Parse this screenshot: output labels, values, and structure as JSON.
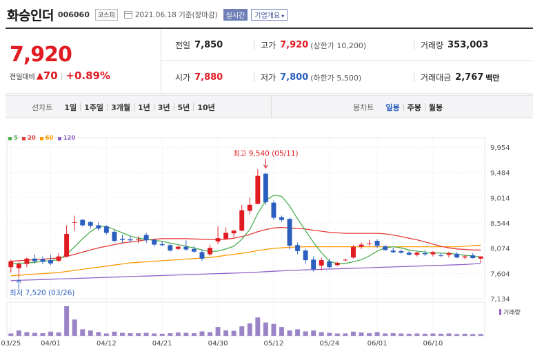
{
  "header": {
    "name": "화승인더",
    "code": "006060",
    "market": "코스피",
    "date": "2021.06.18 기준(장마감)",
    "realtime": "실시간",
    "company_info": "기업개요"
  },
  "quote": {
    "current": "7,920",
    "change_label": "전일대비",
    "change_amount": "70",
    "change_percent": "+0.89%",
    "prev_close_label": "전일",
    "prev_close": "7,850",
    "high_label": "고가",
    "high": "7,920",
    "upper_limit": "(상한가 10,200)",
    "volume_label": "거래량",
    "volume": "353,003",
    "open_label": "시가",
    "open": "7,880",
    "low_label": "저가",
    "low": "7,800",
    "lower_limit": "(하한가 5,500)",
    "amount_label": "거래대금",
    "amount": "2,767",
    "amount_unit": "백만"
  },
  "period_bar": {
    "line_chart_label": "선차트",
    "ranges": [
      "1일",
      "1주일",
      "3개월",
      "1년",
      "3년",
      "5년",
      "10년"
    ],
    "candle_label": "봉차트",
    "candle_options": [
      "일봉",
      "주봉",
      "월봉"
    ],
    "active_candle": "일봉"
  },
  "colors": {
    "up": "#e11b22",
    "down": "#2b5fbf",
    "ma5": "#4caf50",
    "ma20": "#e53935",
    "ma60": "#ff9800",
    "ma120": "#8e63c9",
    "volume": "#9a84c7"
  },
  "legend": [
    {
      "label": "5",
      "color": "#4caf50"
    },
    {
      "label": "20",
      "color": "#e53935"
    },
    {
      "label": "60",
      "color": "#ff9800"
    },
    {
      "label": "120",
      "color": "#8e63c9"
    }
  ],
  "chart_data": {
    "type": "candlestick",
    "y_ticks": [
      "9,954",
      "9,484",
      "9,014",
      "8,544",
      "8,074",
      "7,604",
      "7,134"
    ],
    "ylim": [
      7134,
      9954
    ],
    "x_ticks": [
      {
        "label": "03/25",
        "index": 0
      },
      {
        "label": "04/01",
        "index": 5
      },
      {
        "label": "04/12",
        "index": 12
      },
      {
        "label": "04/21",
        "index": 19
      },
      {
        "label": "04/30",
        "index": 26
      },
      {
        "label": "05/12",
        "index": 33
      },
      {
        "label": "05/24",
        "index": 40
      },
      {
        "label": "06/01",
        "index": 46
      },
      {
        "label": "06/10",
        "index": 53
      }
    ],
    "high_annotation": {
      "text": "최고 9,540 (05/11)",
      "value": 9540,
      "index": 32
    },
    "low_annotation": {
      "text": "최저 7,520 (03/26)",
      "value": 7520,
      "index": 1
    },
    "volume_label": "거래량",
    "candles": [
      {
        "o": 7720,
        "h": 7860,
        "l": 7620,
        "c": 7830
      },
      {
        "o": 7700,
        "h": 7820,
        "l": 7520,
        "c": 7780
      },
      {
        "o": 7780,
        "h": 7900,
        "l": 7720,
        "c": 7880
      },
      {
        "o": 7880,
        "h": 7960,
        "l": 7790,
        "c": 7830
      },
      {
        "o": 7870,
        "h": 7920,
        "l": 7780,
        "c": 7820
      },
      {
        "o": 7850,
        "h": 7950,
        "l": 7760,
        "c": 7790
      },
      {
        "o": 7840,
        "h": 7980,
        "l": 7810,
        "c": 7920
      },
      {
        "o": 7920,
        "h": 8500,
        "l": 7900,
        "c": 8340
      },
      {
        "o": 8550,
        "h": 8680,
        "l": 8400,
        "c": 8560
      },
      {
        "o": 8600,
        "h": 8620,
        "l": 8480,
        "c": 8500
      },
      {
        "o": 8560,
        "h": 8580,
        "l": 8440,
        "c": 8490
      },
      {
        "o": 8500,
        "h": 8560,
        "l": 8400,
        "c": 8440
      },
      {
        "o": 8480,
        "h": 8500,
        "l": 8330,
        "c": 8360
      },
      {
        "o": 8380,
        "h": 8420,
        "l": 8180,
        "c": 8210
      },
      {
        "o": 8250,
        "h": 8320,
        "l": 8170,
        "c": 8230
      },
      {
        "o": 8240,
        "h": 8300,
        "l": 8180,
        "c": 8220
      },
      {
        "o": 8230,
        "h": 8300,
        "l": 8170,
        "c": 8240
      },
      {
        "o": 8320,
        "h": 8360,
        "l": 8170,
        "c": 8220
      },
      {
        "o": 8230,
        "h": 8250,
        "l": 8100,
        "c": 8140
      },
      {
        "o": 8150,
        "h": 8200,
        "l": 8110,
        "c": 8130
      },
      {
        "o": 8130,
        "h": 8150,
        "l": 8010,
        "c": 8030
      },
      {
        "o": 8060,
        "h": 8120,
        "l": 8040,
        "c": 8100
      },
      {
        "o": 8100,
        "h": 8220,
        "l": 8020,
        "c": 8050
      },
      {
        "o": 8060,
        "h": 8120,
        "l": 7980,
        "c": 8010
      },
      {
        "o": 8000,
        "h": 8050,
        "l": 7840,
        "c": 7880
      },
      {
        "o": 7960,
        "h": 8140,
        "l": 7930,
        "c": 8080
      },
      {
        "o": 8200,
        "h": 8480,
        "l": 8150,
        "c": 8260
      },
      {
        "o": 8250,
        "h": 8460,
        "l": 8230,
        "c": 8360
      },
      {
        "o": 8350,
        "h": 8420,
        "l": 8280,
        "c": 8400
      },
      {
        "o": 8400,
        "h": 8880,
        "l": 8390,
        "c": 8780
      },
      {
        "o": 8770,
        "h": 9020,
        "l": 8700,
        "c": 8880
      },
      {
        "o": 8900,
        "h": 9540,
        "l": 8900,
        "c": 9420
      },
      {
        "o": 9460,
        "h": 9480,
        "l": 8880,
        "c": 8930
      },
      {
        "o": 8920,
        "h": 8960,
        "l": 8600,
        "c": 8640
      },
      {
        "o": 8650,
        "h": 8680,
        "l": 8560,
        "c": 8600
      },
      {
        "o": 8620,
        "h": 8640,
        "l": 8050,
        "c": 8120
      },
      {
        "o": 8130,
        "h": 8180,
        "l": 7960,
        "c": 8020
      },
      {
        "o": 8030,
        "h": 8060,
        "l": 7780,
        "c": 7850
      },
      {
        "o": 7860,
        "h": 7920,
        "l": 7640,
        "c": 7680
      },
      {
        "o": 7750,
        "h": 7900,
        "l": 7660,
        "c": 7850
      },
      {
        "o": 7830,
        "h": 7880,
        "l": 7700,
        "c": 7720
      },
      {
        "o": 7760,
        "h": 7820,
        "l": 7740,
        "c": 7800
      },
      {
        "o": 7850,
        "h": 7880,
        "l": 7820,
        "c": 7860
      },
      {
        "o": 7900,
        "h": 8130,
        "l": 7880,
        "c": 8100
      },
      {
        "o": 8100,
        "h": 8180,
        "l": 8060,
        "c": 8140
      },
      {
        "o": 8150,
        "h": 8230,
        "l": 8120,
        "c": 8160
      },
      {
        "o": 8210,
        "h": 8240,
        "l": 8080,
        "c": 8120
      },
      {
        "o": 8110,
        "h": 8130,
        "l": 8020,
        "c": 8040
      },
      {
        "o": 8030,
        "h": 8080,
        "l": 7980,
        "c": 8000
      },
      {
        "o": 8020,
        "h": 8050,
        "l": 7970,
        "c": 7990
      },
      {
        "o": 7990,
        "h": 8020,
        "l": 7940,
        "c": 7950
      },
      {
        "o": 7950,
        "h": 8010,
        "l": 7920,
        "c": 7990
      },
      {
        "o": 7980,
        "h": 8040,
        "l": 7930,
        "c": 7960
      },
      {
        "o": 7960,
        "h": 8020,
        "l": 7920,
        "c": 8000
      },
      {
        "o": 7940,
        "h": 7990,
        "l": 7910,
        "c": 7930
      },
      {
        "o": 7950,
        "h": 8010,
        "l": 7900,
        "c": 7980
      },
      {
        "o": 7970,
        "h": 8000,
        "l": 7890,
        "c": 7900
      },
      {
        "o": 7900,
        "h": 7950,
        "l": 7870,
        "c": 7920
      },
      {
        "o": 7940,
        "h": 7980,
        "l": 7880,
        "c": 7890
      },
      {
        "o": 7880,
        "h": 7920,
        "l": 7800,
        "c": 7920
      }
    ],
    "volumes": [
      8,
      18,
      12,
      10,
      9,
      14,
      11,
      100,
      55,
      22,
      18,
      12,
      8,
      14,
      10,
      9,
      9,
      10,
      8,
      7,
      9,
      11,
      10,
      9,
      15,
      12,
      30,
      18,
      17,
      32,
      42,
      62,
      45,
      40,
      30,
      18,
      22,
      15,
      18,
      12,
      10,
      8,
      8,
      14,
      11,
      9,
      12,
      8,
      9,
      8,
      7,
      8,
      7,
      8,
      7,
      8,
      6,
      7,
      6,
      6
    ],
    "ma5": [
      7780,
      7790,
      7800,
      7810,
      7830,
      7840,
      7860,
      7960,
      8100,
      8250,
      8380,
      8480,
      8480,
      8420,
      8360,
      8300,
      8260,
      8240,
      8220,
      8200,
      8170,
      8140,
      8110,
      8080,
      8040,
      8010,
      8020,
      8060,
      8110,
      8240,
      8420,
      8720,
      8960,
      9060,
      9040,
      8860,
      8620,
      8400,
      8180,
      7990,
      7830,
      7790,
      7790,
      7820,
      7860,
      7930,
      8020,
      8080,
      8100,
      8080,
      8040,
      8020,
      8000,
      7990,
      7980,
      7980,
      7960,
      7940,
      7930,
      7910
    ],
    "ma20": [
      7830,
      7840,
      7850,
      7860,
      7870,
      7880,
      7890,
      7920,
      7960,
      8000,
      8040,
      8080,
      8110,
      8140,
      8170,
      8190,
      8210,
      8230,
      8240,
      8250,
      8250,
      8250,
      8250,
      8245,
      8240,
      8235,
      8230,
      8240,
      8260,
      8290,
      8330,
      8380,
      8420,
      8450,
      8460,
      8450,
      8440,
      8430,
      8410,
      8390,
      8370,
      8360,
      8350,
      8350,
      8350,
      8350,
      8350,
      8340,
      8320,
      8290,
      8260,
      8230,
      8190,
      8150,
      8110,
      8080,
      8060,
      8050,
      8040,
      8040
    ],
    "ma60": [
      7560,
      7570,
      7580,
      7590,
      7600,
      7610,
      7620,
      7640,
      7660,
      7680,
      7700,
      7720,
      7740,
      7760,
      7780,
      7800,
      7810,
      7820,
      7830,
      7840,
      7850,
      7860,
      7870,
      7880,
      7890,
      7900,
      7920,
      7940,
      7960,
      7980,
      8000,
      8030,
      8050,
      8070,
      8080,
      8090,
      8095,
      8100,
      8100,
      8100,
      8100,
      8100,
      8100,
      8100,
      8100,
      8100,
      8100,
      8100,
      8100,
      8100,
      8100,
      8100,
      8100,
      8100,
      8100,
      8100,
      8100,
      8110,
      8120,
      8130
    ],
    "ma120": [
      7470,
      7475,
      7480,
      7485,
      7490,
      7495,
      7500,
      7505,
      7510,
      7515,
      7520,
      7525,
      7530,
      7535,
      7540,
      7545,
      7550,
      7555,
      7560,
      7565,
      7570,
      7575,
      7580,
      7585,
      7590,
      7595,
      7600,
      7605,
      7610,
      7615,
      7620,
      7628,
      7636,
      7644,
      7652,
      7660,
      7665,
      7670,
      7675,
      7680,
      7685,
      7690,
      7695,
      7700,
      7705,
      7710,
      7715,
      7720,
      7725,
      7730,
      7735,
      7740,
      7745,
      7750,
      7755,
      7760,
      7765,
      7770,
      7780,
      7790
    ]
  }
}
